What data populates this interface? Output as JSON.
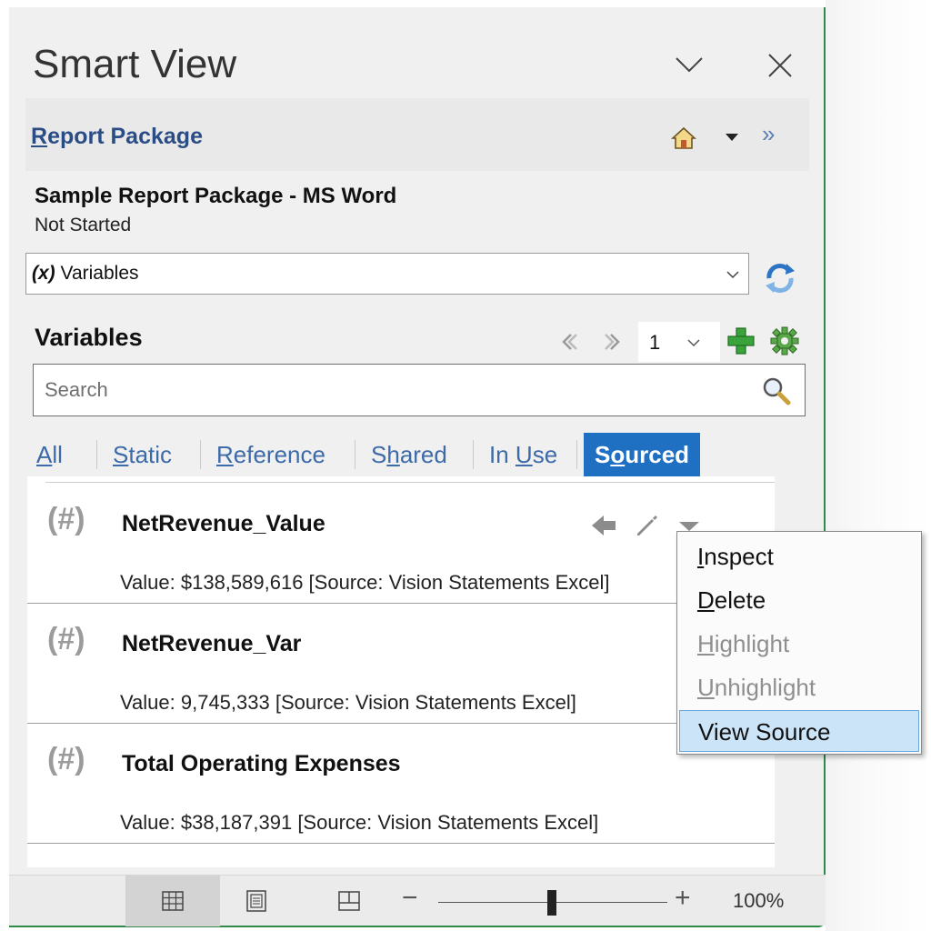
{
  "pane": {
    "title": "Smart View",
    "report_package": {
      "link_first": "R",
      "link_rest": "eport Package"
    },
    "package_name": "Sample Report Package - MS Word",
    "package_status": "Not Started"
  },
  "dropdown": {
    "prefix": "(x)",
    "value": "Variables"
  },
  "variables": {
    "header": "Variables",
    "page": "1",
    "search_placeholder": "Search"
  },
  "tabs": [
    {
      "pre": "",
      "u": "A",
      "post": "ll",
      "active": false
    },
    {
      "pre": "",
      "u": "S",
      "post": "tatic",
      "active": false
    },
    {
      "pre": "",
      "u": "R",
      "post": "eference",
      "active": false
    },
    {
      "pre": "S",
      "u": "h",
      "post": "ared",
      "active": false
    },
    {
      "pre": "In ",
      "u": "U",
      "post": "se",
      "active": false
    },
    {
      "pre": "S",
      "u": "o",
      "post": "urced",
      "active": true
    }
  ],
  "rows": [
    {
      "hash": "(#)",
      "name": "NetRevenue_Value",
      "value": "Value:  $138,589,616  [Source: Vision Statements Excel]"
    },
    {
      "hash": "(#)",
      "name": "NetRevenue_Var",
      "value": "Value:  9,745,333  [Source: Vision Statements Excel]"
    },
    {
      "hash": "(#)",
      "name": "Total Operating Expenses",
      "value": "Value:  $38,187,391  [Source: Vision Statements Excel]"
    }
  ],
  "context_menu": [
    {
      "u": "I",
      "rest": "nspect",
      "state": "enabled"
    },
    {
      "u": "D",
      "rest": "elete",
      "state": "enabled"
    },
    {
      "u": "H",
      "rest": "ighlight",
      "state": "disabled"
    },
    {
      "u": "U",
      "rest": "nhighlight",
      "state": "disabled"
    },
    {
      "u": "",
      "rest": "View Source",
      "state": "highlighted"
    }
  ],
  "status_bar": {
    "zoom_minus": "−",
    "zoom_plus": "+",
    "zoom_percent": "100%",
    "zoom_level": 1.0
  },
  "colors": {
    "accent": "#1f6fc2",
    "link": "#2a4d86",
    "window_border": "#2f8a4a",
    "menu_highlight": "#cce4f7"
  },
  "icons": [
    "chevron-down-icon",
    "close-icon",
    "home-icon",
    "dropdown-arrow-icon",
    "double-chevron-icon",
    "refresh-icon",
    "prev-icon",
    "next-icon",
    "add-icon",
    "gear-icon",
    "search-icon",
    "reference-arrow-icon",
    "edit-pencil-icon",
    "row-menu-arrow-icon",
    "normal-view-icon",
    "page-layout-icon",
    "page-break-icon"
  ]
}
